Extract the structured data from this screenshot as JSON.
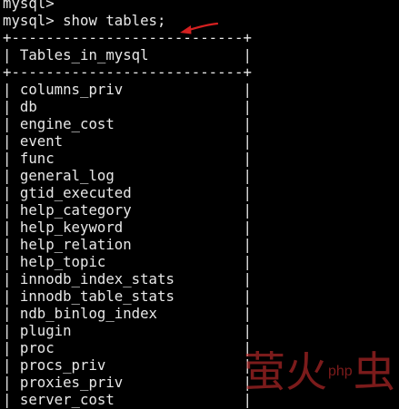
{
  "terminal": {
    "lines": [
      "mysql>",
      "mysql> show tables;",
      "+---------------------------+",
      "| Tables_in_mysql           |",
      "+---------------------------+",
      "| columns_priv              |",
      "| db                        |",
      "| engine_cost               |",
      "| event                     |",
      "| func                      |",
      "| general_log               |",
      "| gtid_executed             |",
      "| help_category             |",
      "| help_keyword              |",
      "| help_relation             |",
      "| help_topic                |",
      "| innodb_index_stats        |",
      "| innodb_table_stats        |",
      "| ndb_binlog_index          |",
      "| plugin                    |",
      "| proc                      |",
      "| procs_priv                |",
      "| proxies_priv              |",
      "| server_cost               |"
    ]
  },
  "annotation": {
    "icon": "arrow-left-icon",
    "color": "#d42020"
  },
  "watermark": {
    "left": "萤火",
    "php": "php",
    "right": "虫",
    "color": "#c72c2c"
  }
}
